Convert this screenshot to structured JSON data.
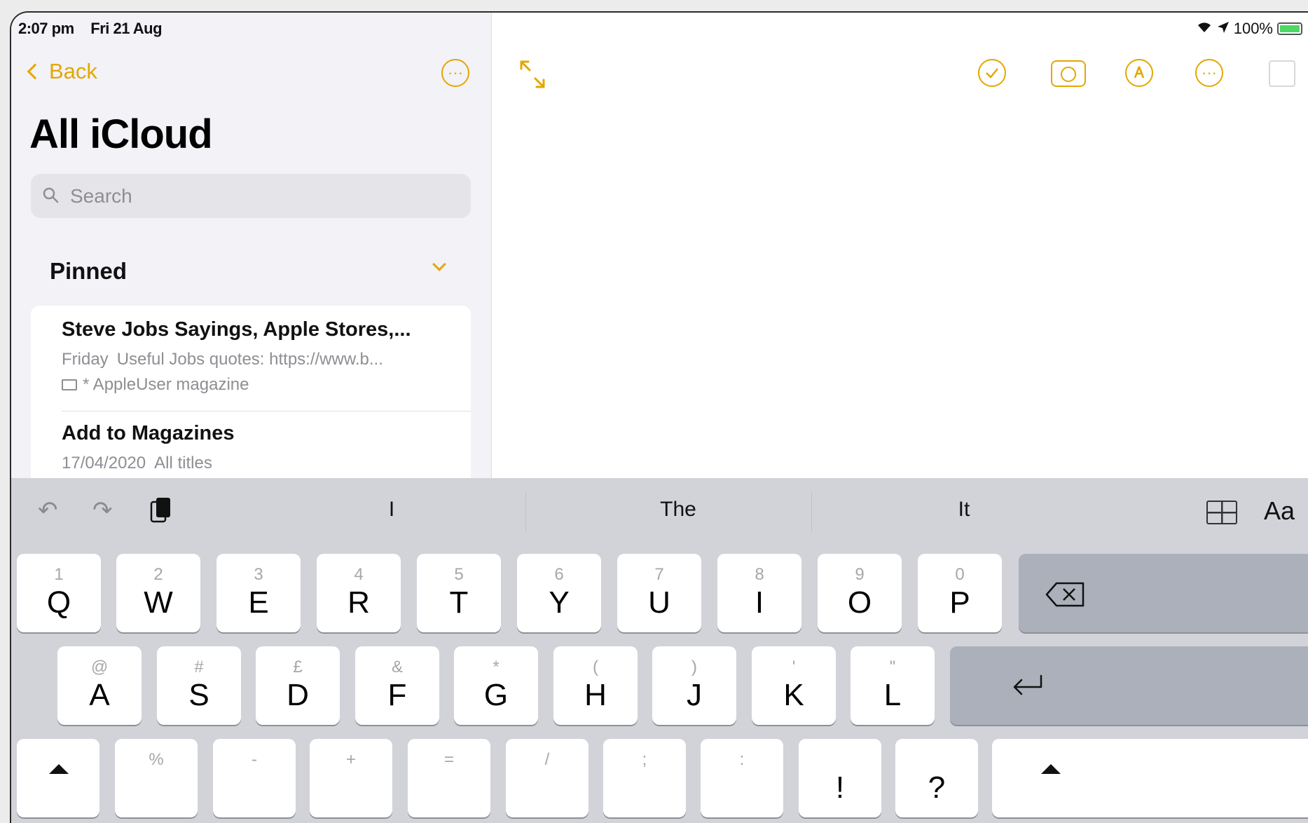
{
  "status": {
    "time": "2:07 pm",
    "date": "Fri 21 Aug",
    "battery": "100%"
  },
  "sidebar": {
    "back_label": "Back",
    "title": "All iCloud",
    "search_placeholder": "Search",
    "pinned_label": "Pinned",
    "notes": [
      {
        "title": "Steve Jobs Sayings, Apple Stores,...",
        "date": "Friday",
        "preview": "Useful Jobs quotes: https://www.b...",
        "folder": "* AppleUser magazine"
      },
      {
        "title": "Add to Magazines",
        "date": "17/04/2020",
        "preview": "All titles"
      }
    ]
  },
  "toolbar": {
    "icons": [
      "expand-icon",
      "checklist-icon",
      "camera-icon",
      "markup-icon",
      "more-icon",
      "compose-icon"
    ]
  },
  "keyboard": {
    "suggestions": [
      "I",
      "The",
      "It"
    ],
    "format_label": "Aa",
    "row1": [
      {
        "sec": "1",
        "pri": "Q"
      },
      {
        "sec": "2",
        "pri": "W"
      },
      {
        "sec": "3",
        "pri": "E"
      },
      {
        "sec": "4",
        "pri": "R"
      },
      {
        "sec": "5",
        "pri": "T"
      },
      {
        "sec": "6",
        "pri": "Y"
      },
      {
        "sec": "7",
        "pri": "U"
      },
      {
        "sec": "8",
        "pri": "I"
      },
      {
        "sec": "9",
        "pri": "O"
      },
      {
        "sec": "0",
        "pri": "P"
      }
    ],
    "row2": [
      {
        "sec": "@",
        "pri": "A"
      },
      {
        "sec": "#",
        "pri": "S"
      },
      {
        "sec": "£",
        "pri": "D"
      },
      {
        "sec": "&",
        "pri": "F"
      },
      {
        "sec": "*",
        "pri": "G"
      },
      {
        "sec": "(",
        "pri": "H"
      },
      {
        "sec": ")",
        "pri": "J"
      },
      {
        "sec": "'",
        "pri": "K"
      },
      {
        "sec": "\"",
        "pri": "L"
      }
    ],
    "row3": [
      {
        "sec": "%",
        "pri": ""
      },
      {
        "sec": "-",
        "pri": ""
      },
      {
        "sec": "+",
        "pri": ""
      },
      {
        "sec": "=",
        "pri": ""
      },
      {
        "sec": "/",
        "pri": ""
      },
      {
        "sec": ";",
        "pri": ""
      },
      {
        "sec": ":",
        "pri": ""
      },
      {
        "sec": "",
        "pri": "!"
      },
      {
        "sec": "",
        "pri": "?"
      }
    ]
  },
  "colors": {
    "accent": "#e3a700",
    "keyboard_bg": "#d1d3d9"
  }
}
